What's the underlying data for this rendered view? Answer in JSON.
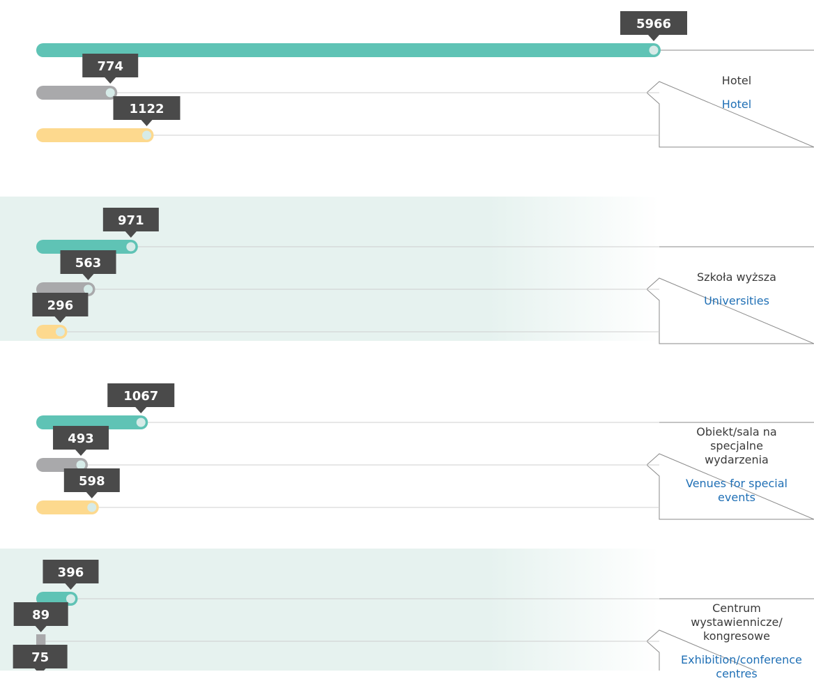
{
  "chart_data": {
    "type": "bar",
    "orientation": "horizontal",
    "categories": [
      {
        "label_pl": "Hotel",
        "label_en": "Hotel"
      },
      {
        "label_pl": "Szkoła wyższa",
        "label_en": "Universities"
      },
      {
        "label_pl": "Obiekt/sala na specjalne wydarzenia",
        "label_en": "Venues for special events"
      },
      {
        "label_pl": "Centrum wystawiennicze/ kongresowe",
        "label_en": "Exhibition/conference centres"
      }
    ],
    "series": [
      {
        "color": "#5fc3b5",
        "values": [
          5966,
          971,
          1067,
          396
        ]
      },
      {
        "color": "#a9a9ab",
        "values": [
          774,
          563,
          493,
          89
        ]
      },
      {
        "color": "#fdd98e",
        "values": [
          1122,
          296,
          598,
          75
        ]
      }
    ],
    "data_labels_shown": true,
    "xlim": [
      0,
      5966
    ],
    "grid": false,
    "legend": "none",
    "label_box_color": "#4a4a4a",
    "band_color": "#e6f2ef"
  }
}
